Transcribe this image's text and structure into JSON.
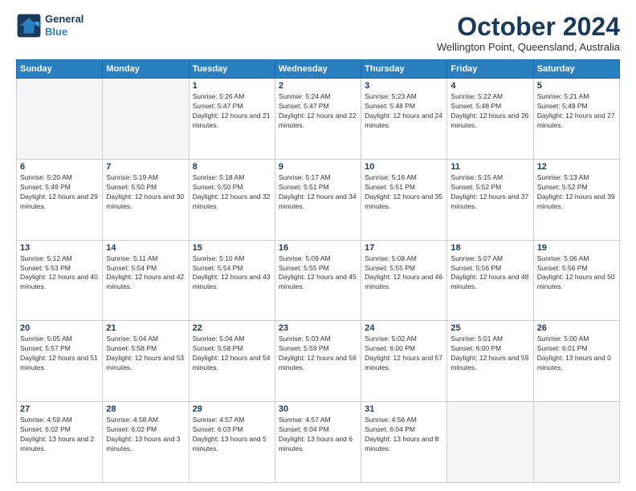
{
  "logo": {
    "line1": "General",
    "line2": "Blue"
  },
  "header": {
    "month": "October 2024",
    "location": "Wellington Point, Queensland, Australia"
  },
  "weekdays": [
    "Sunday",
    "Monday",
    "Tuesday",
    "Wednesday",
    "Thursday",
    "Friday",
    "Saturday"
  ],
  "weeks": [
    [
      {
        "day": "",
        "empty": true
      },
      {
        "day": "",
        "empty": true
      },
      {
        "day": "1",
        "sunrise": "5:26 AM",
        "sunset": "5:47 PM",
        "daylight": "12 hours and 21 minutes."
      },
      {
        "day": "2",
        "sunrise": "5:24 AM",
        "sunset": "5:47 PM",
        "daylight": "12 hours and 22 minutes."
      },
      {
        "day": "3",
        "sunrise": "5:23 AM",
        "sunset": "5:48 PM",
        "daylight": "12 hours and 24 minutes."
      },
      {
        "day": "4",
        "sunrise": "5:22 AM",
        "sunset": "5:48 PM",
        "daylight": "12 hours and 26 minutes."
      },
      {
        "day": "5",
        "sunrise": "5:21 AM",
        "sunset": "5:49 PM",
        "daylight": "12 hours and 27 minutes."
      }
    ],
    [
      {
        "day": "6",
        "sunrise": "5:20 AM",
        "sunset": "5:49 PM",
        "daylight": "12 hours and 29 minutes."
      },
      {
        "day": "7",
        "sunrise": "5:19 AM",
        "sunset": "5:50 PM",
        "daylight": "12 hours and 30 minutes."
      },
      {
        "day": "8",
        "sunrise": "5:18 AM",
        "sunset": "5:50 PM",
        "daylight": "12 hours and 32 minutes."
      },
      {
        "day": "9",
        "sunrise": "5:17 AM",
        "sunset": "5:51 PM",
        "daylight": "12 hours and 34 minutes."
      },
      {
        "day": "10",
        "sunrise": "5:16 AM",
        "sunset": "5:51 PM",
        "daylight": "12 hours and 35 minutes."
      },
      {
        "day": "11",
        "sunrise": "5:15 AM",
        "sunset": "5:52 PM",
        "daylight": "12 hours and 37 minutes."
      },
      {
        "day": "12",
        "sunrise": "5:13 AM",
        "sunset": "5:52 PM",
        "daylight": "12 hours and 39 minutes."
      }
    ],
    [
      {
        "day": "13",
        "sunrise": "5:12 AM",
        "sunset": "5:53 PM",
        "daylight": "12 hours and 40 minutes."
      },
      {
        "day": "14",
        "sunrise": "5:11 AM",
        "sunset": "5:54 PM",
        "daylight": "12 hours and 42 minutes."
      },
      {
        "day": "15",
        "sunrise": "5:10 AM",
        "sunset": "5:54 PM",
        "daylight": "12 hours and 43 minutes."
      },
      {
        "day": "16",
        "sunrise": "5:09 AM",
        "sunset": "5:55 PM",
        "daylight": "12 hours and 45 minutes."
      },
      {
        "day": "17",
        "sunrise": "5:08 AM",
        "sunset": "5:55 PM",
        "daylight": "12 hours and 46 minutes."
      },
      {
        "day": "18",
        "sunrise": "5:07 AM",
        "sunset": "5:56 PM",
        "daylight": "12 hours and 48 minutes."
      },
      {
        "day": "19",
        "sunrise": "5:06 AM",
        "sunset": "5:56 PM",
        "daylight": "12 hours and 50 minutes."
      }
    ],
    [
      {
        "day": "20",
        "sunrise": "5:05 AM",
        "sunset": "5:57 PM",
        "daylight": "12 hours and 51 minutes."
      },
      {
        "day": "21",
        "sunrise": "5:04 AM",
        "sunset": "5:58 PM",
        "daylight": "12 hours and 53 minutes."
      },
      {
        "day": "22",
        "sunrise": "5:04 AM",
        "sunset": "5:58 PM",
        "daylight": "12 hours and 54 minutes."
      },
      {
        "day": "23",
        "sunrise": "5:03 AM",
        "sunset": "5:59 PM",
        "daylight": "12 hours and 56 minutes."
      },
      {
        "day": "24",
        "sunrise": "5:02 AM",
        "sunset": "6:00 PM",
        "daylight": "12 hours and 57 minutes."
      },
      {
        "day": "25",
        "sunrise": "5:01 AM",
        "sunset": "6:00 PM",
        "daylight": "12 hours and 59 minutes."
      },
      {
        "day": "26",
        "sunrise": "5:00 AM",
        "sunset": "6:01 PM",
        "daylight": "13 hours and 0 minutes."
      }
    ],
    [
      {
        "day": "27",
        "sunrise": "4:59 AM",
        "sunset": "6:02 PM",
        "daylight": "13 hours and 2 minutes."
      },
      {
        "day": "28",
        "sunrise": "4:58 AM",
        "sunset": "6:02 PM",
        "daylight": "13 hours and 3 minutes."
      },
      {
        "day": "29",
        "sunrise": "4:57 AM",
        "sunset": "6:03 PM",
        "daylight": "13 hours and 5 minutes."
      },
      {
        "day": "30",
        "sunrise": "4:57 AM",
        "sunset": "6:04 PM",
        "daylight": "13 hours and 6 minutes."
      },
      {
        "day": "31",
        "sunrise": "4:56 AM",
        "sunset": "6:04 PM",
        "daylight": "13 hours and 8 minutes."
      },
      {
        "day": "",
        "empty": true
      },
      {
        "day": "",
        "empty": true
      }
    ]
  ]
}
